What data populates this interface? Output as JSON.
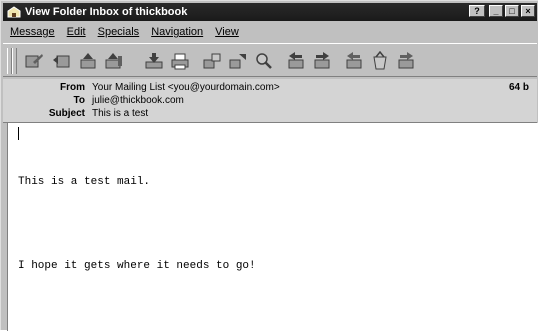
{
  "window": {
    "title": "View Folder Inbox of thickbook",
    "controls": {
      "help": "?",
      "minimize": "_",
      "maximize": "□",
      "close": "×"
    }
  },
  "menubar": {
    "items": [
      {
        "label": "Message"
      },
      {
        "label": "Edit"
      },
      {
        "label": "Specials"
      },
      {
        "label": "Navigation"
      },
      {
        "label": "View"
      }
    ]
  },
  "toolbar": {
    "icons": [
      "compose-icon",
      "reply-icon",
      "reply-all-icon",
      "forward-icon",
      "save-icon",
      "print-icon",
      "copy-to-folder-icon",
      "move-to-folder-icon",
      "search-icon",
      "previous-message-icon",
      "next-message-icon",
      "previous-unread-icon",
      "delete-icon",
      "next-unread-icon"
    ]
  },
  "header": {
    "from_label": "From",
    "from_value": "Your Mailing List <you@yourdomain.com>",
    "to_label": "To",
    "to_value": "julie@thickbook.com",
    "subject_label": "Subject",
    "subject_value": "This is a test",
    "size": "64 b"
  },
  "message": {
    "lines": [
      "This is a test mail.",
      "",
      "I hope it gets where it needs to go!"
    ]
  }
}
